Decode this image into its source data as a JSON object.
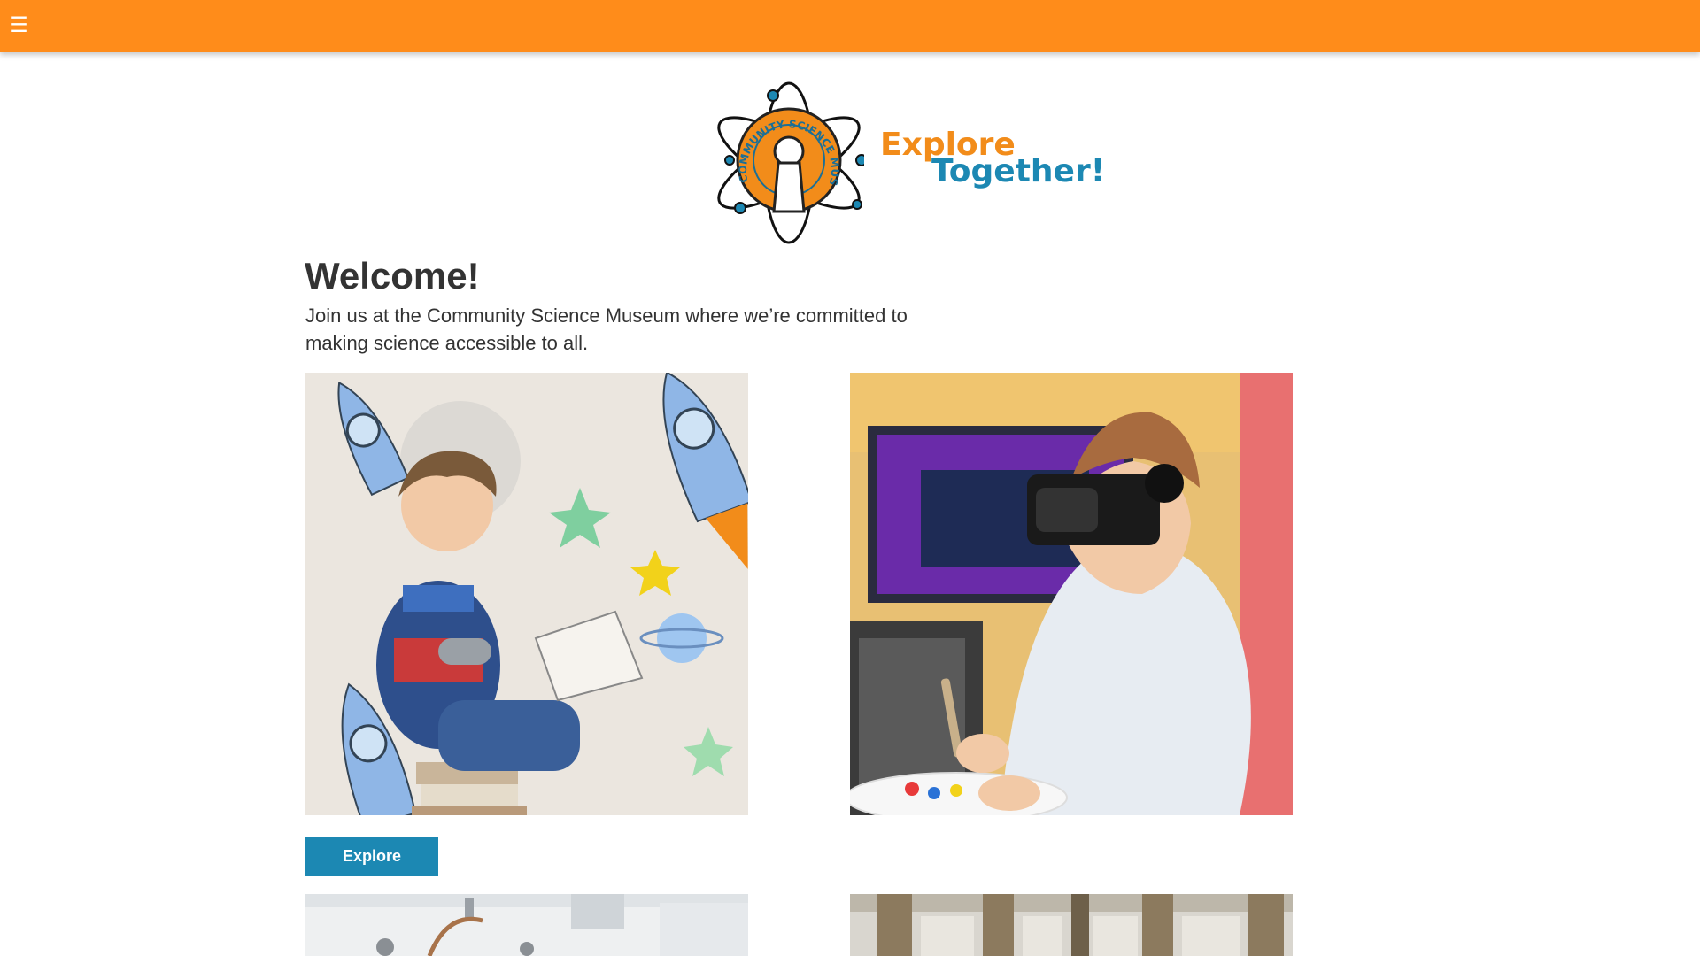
{
  "header": {
    "menu_icon": "hamburger-menu-icon",
    "menu_glyph": "☰",
    "background_color": "#ff8c1a"
  },
  "logo": {
    "ring_text": "COMMUNITY SCIENCE MUSEUM",
    "tagline_line1": "Explore",
    "tagline_line2": "Together!",
    "orange": "#f28c1a",
    "blue": "#1c88b3"
  },
  "welcome": {
    "title": "Welcome!",
    "text": "Join us at the Community Science Museum where we’re committed to making science accessible to all."
  },
  "cards": [
    {
      "image": "child-reading-book-with-rocket-illustrations",
      "button_label": "Explore"
    },
    {
      "image": "teen-with-vr-headset-painting"
    },
    {
      "image": "museum-interior-partial"
    },
    {
      "image": "ornate-hall-columns-partial"
    }
  ],
  "colors": {
    "accent_orange": "#ff8c1a",
    "button_blue": "#1c88b3",
    "text": "#333333"
  }
}
